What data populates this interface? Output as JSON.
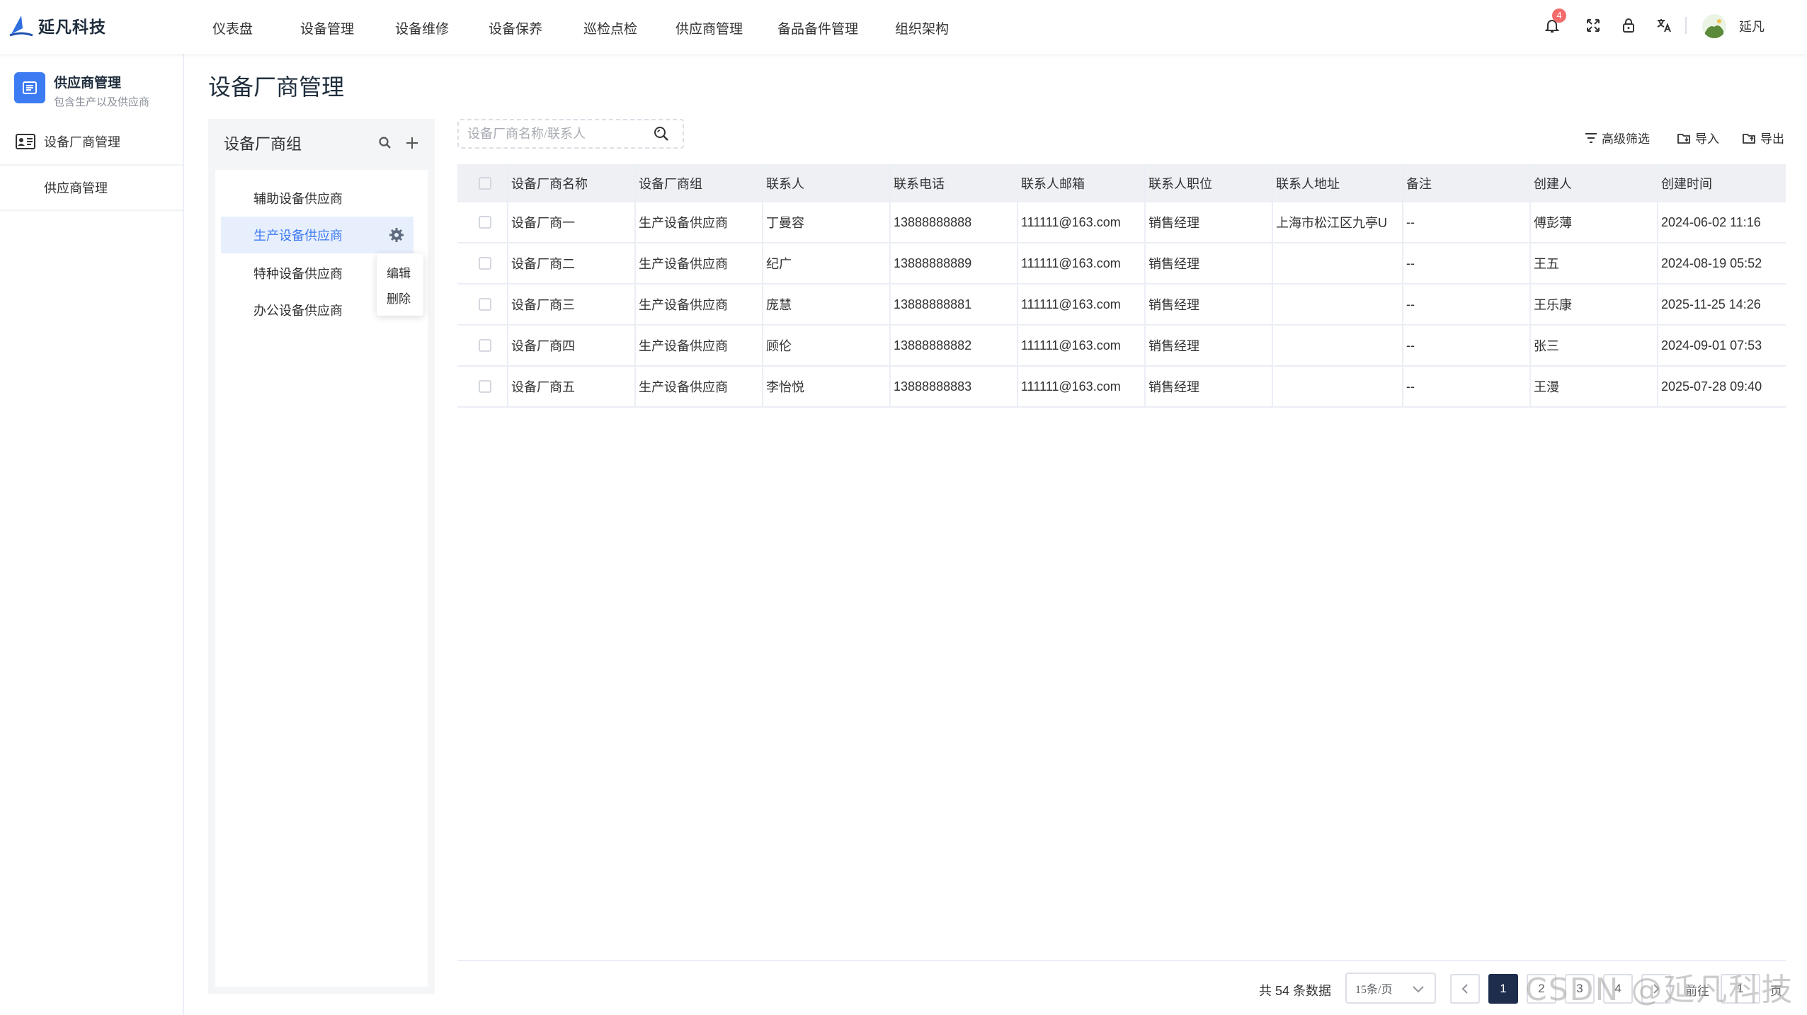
{
  "app": {
    "logo_text": "延凡科技"
  },
  "nav": {
    "items": [
      "仪表盘",
      "设备管理",
      "设备维修",
      "设备保养",
      "巡检点检",
      "供应商管理",
      "备品备件管理",
      "组织架构"
    ]
  },
  "header": {
    "notification_count": "4",
    "username": "延凡"
  },
  "sidebar": {
    "title": "供应商管理",
    "subtitle": "包含生产以及供应商",
    "items": [
      {
        "label": "设备厂商管理"
      },
      {
        "label": "供应商管理"
      }
    ]
  },
  "page": {
    "title": "设备厂商管理"
  },
  "groups": {
    "title": "设备厂商组",
    "items": [
      "辅助设备供应商",
      "生产设备供应商",
      "特种设备供应商",
      "办公设备供应商"
    ],
    "context_menu": [
      "编辑",
      "删除"
    ]
  },
  "search": {
    "placeholder": "设备厂商名称/联系人"
  },
  "toolbar": {
    "filter_label": "高级筛选",
    "import_label": "导入",
    "export_label": "导出"
  },
  "table": {
    "columns": [
      "设备厂商名称",
      "设备厂商组",
      "联系人",
      "联系电话",
      "联系人邮箱",
      "联系人职位",
      "联系人地址",
      "备注",
      "创建人",
      "创建时间"
    ],
    "rows": [
      [
        "设备厂商一",
        "生产设备供应商",
        "丁曼容",
        "13888888888",
        "111111@163.com",
        "销售经理",
        "上海市松江区九亭U",
        "--",
        "傅彭薄",
        "2024-06-02 11:16"
      ],
      [
        "设备厂商二",
        "生产设备供应商",
        "纪广",
        "13888888889",
        "111111@163.com",
        "销售经理",
        "",
        "--",
        "王五",
        "2024-08-19 05:52"
      ],
      [
        "设备厂商三",
        "生产设备供应商",
        "庞慧",
        "13888888881",
        "111111@163.com",
        "销售经理",
        "",
        "--",
        "王乐康",
        "2025-11-25 14:26"
      ],
      [
        "设备厂商四",
        "生产设备供应商",
        "顾伦",
        "13888888882",
        "111111@163.com",
        "销售经理",
        "",
        "--",
        "张三",
        "2024-09-01 07:53"
      ],
      [
        "设备厂商五",
        "生产设备供应商",
        "李怡悦",
        "13888888883",
        "111111@163.com",
        "销售经理",
        "",
        "--",
        "王漫",
        "2025-07-28 09:40"
      ]
    ]
  },
  "pagination": {
    "total_label": "共 54 条数据",
    "page_size": "15条/页",
    "pages": [
      "1",
      "2",
      "3",
      "4"
    ],
    "goto_label": "前往",
    "page_suffix": "页",
    "goto_value": "1"
  },
  "watermark": "CSDN @延凡科技",
  "colors": {
    "accent": "#3d7bf2",
    "active_page": "#1f2d4d",
    "badge": "#f56c6c"
  }
}
